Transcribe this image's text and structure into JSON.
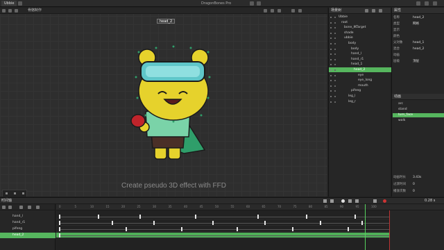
{
  "titlebar": {
    "tab": "Ubbie",
    "title": "DragonBones Pro"
  },
  "viewport": {
    "toolbar_label": "骨骼制作",
    "selected_tag": "head_2",
    "caption": "Create pseudo 3D effect with FFD"
  },
  "hierarchy": {
    "title": "场景树",
    "rows": [
      {
        "label": "Ubbie"
      },
      {
        "label": "root"
      },
      {
        "label": "bone_IKTarget"
      },
      {
        "label": "shade"
      },
      {
        "label": "ubbie"
      },
      {
        "label": "body"
      },
      {
        "label": "body"
      },
      {
        "label": "hand_l"
      },
      {
        "label": "hand_r1"
      },
      {
        "label": "head_1"
      },
      {
        "label": "head_2"
      },
      {
        "label": "eye"
      },
      {
        "label": "eye_long"
      },
      {
        "label": "mouth"
      },
      {
        "label": "pifeng"
      },
      {
        "label": "leg_l"
      },
      {
        "label": "leg_r"
      }
    ]
  },
  "properties": {
    "title": "属性",
    "fields": [
      {
        "label": "名称",
        "value": "head_2"
      },
      {
        "label": "类型",
        "value": "网格"
      },
      {
        "label": "显示",
        "value": ""
      },
      {
        "label": "颜色",
        "value": ""
      },
      {
        "label": "父对象",
        "value": "head_1"
      },
      {
        "label": "混合",
        "value": "head_2"
      },
      {
        "label": "动画",
        "value": ""
      },
      {
        "label": "层级",
        "value": "顶层"
      }
    ],
    "anim_title": "动画",
    "animations": [
      {
        "label": "arc"
      },
      {
        "label": "stand"
      },
      {
        "label": "turn_face"
      },
      {
        "label": "walk"
      }
    ],
    "timing": [
      {
        "label": "动画时长",
        "value": "3.43s"
      },
      {
        "label": "过渡时间",
        "value": "0"
      },
      {
        "label": "播放次数",
        "value": "0"
      }
    ]
  },
  "timeline": {
    "title": "时间轴",
    "zoom": "0.28 s",
    "tracks": [
      {
        "label": "hand_l"
      },
      {
        "label": "hand_r1"
      },
      {
        "label": "pifeng"
      },
      {
        "label": "head_2"
      }
    ],
    "ticks": [
      "0",
      "5",
      "10",
      "15",
      "20",
      "25",
      "30",
      "35",
      "40",
      "45",
      "50",
      "55",
      "60",
      "65",
      "70",
      "75",
      "80",
      "85",
      "90",
      "95",
      "100"
    ]
  }
}
